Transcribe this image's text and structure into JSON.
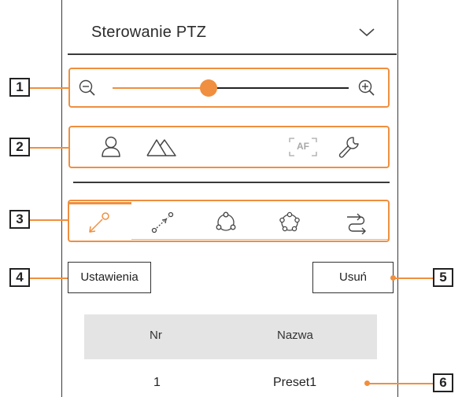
{
  "header": {
    "title": "Sterowanie PTZ"
  },
  "callouts": [
    "1",
    "2",
    "3",
    "4",
    "5",
    "6"
  ],
  "zoom": {
    "level_fraction": 0.4,
    "accent": "#ef8f3f"
  },
  "function_icons": [
    "user-icon",
    "landscape-icon",
    "af-icon",
    "wrench-icon"
  ],
  "af_label": "AF",
  "tabs": [
    "preset-tab-icon",
    "swing-tab-icon",
    "group-tab-icon",
    "tour-tab-icon",
    "trace-tab-icon"
  ],
  "buttons": {
    "settings_label": "Ustawienia",
    "delete_label": "Usuń"
  },
  "table": {
    "columns": [
      "Nr",
      "Nazwa"
    ],
    "rows": [
      {
        "nr": "1",
        "name": "Preset1"
      }
    ]
  },
  "colors": {
    "accent": "#ef8f3f",
    "border": "#3a3a3a",
    "header_bg": "#e4e4e4"
  }
}
